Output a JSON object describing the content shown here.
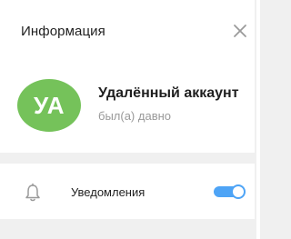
{
  "header": {
    "title": "Информация",
    "close_icon": "close-icon"
  },
  "profile": {
    "avatar_initials": "УА",
    "avatar_color": "#75c25a",
    "name": "Удалённый аккаунт",
    "status": "был(а) давно"
  },
  "notifications": {
    "icon": "bell-icon",
    "label": "Уведомления",
    "enabled": true,
    "toggle_color": "#4ea4f6"
  },
  "colors": {
    "background": "#f0f0f0",
    "card": "#ffffff",
    "secondary_text": "#999999"
  }
}
